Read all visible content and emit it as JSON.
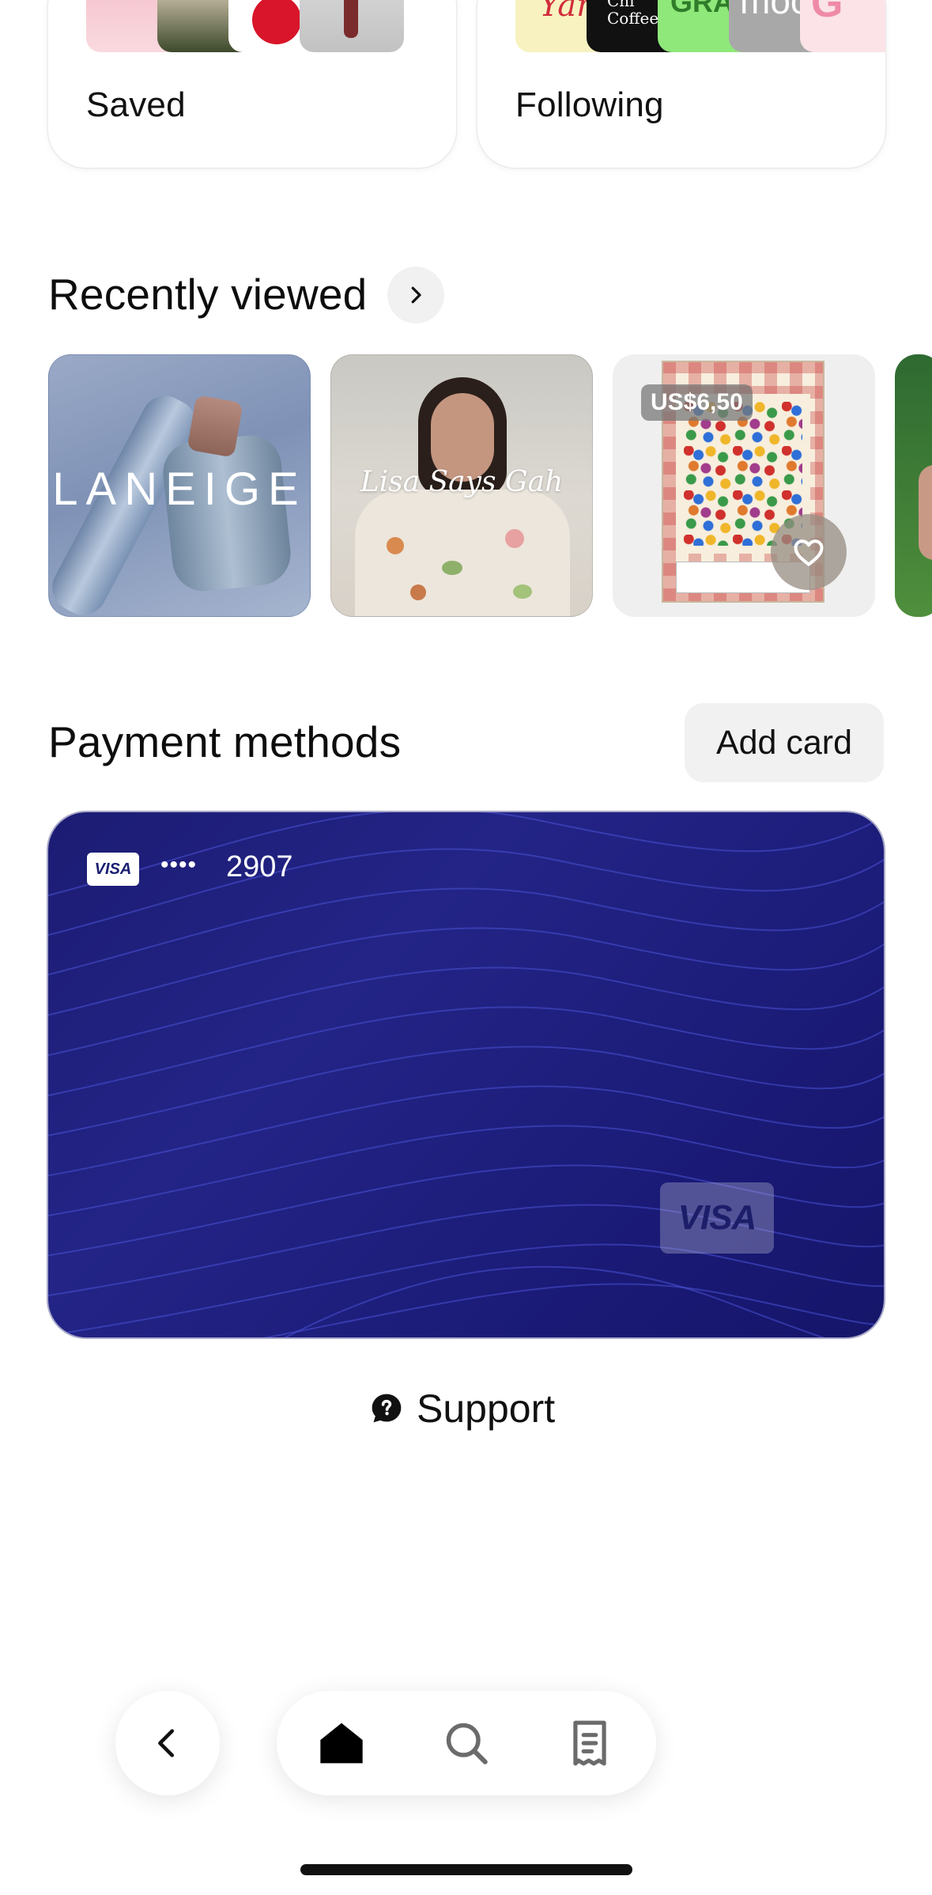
{
  "top_cards": {
    "saved_label": "Saved",
    "following_label": "Following",
    "following_thumbs": [
      "Yan",
      "Chi Coffee",
      "GRAZ",
      "moc",
      "G"
    ]
  },
  "recently_viewed": {
    "title": "Recently viewed",
    "items": [
      {
        "brand_text": "LANEIGE"
      },
      {
        "brand_text": "Lisa Says Gah"
      },
      {
        "price": "US$6,50"
      },
      {}
    ]
  },
  "payment_methods": {
    "title": "Payment methods",
    "add_card_label": "Add card",
    "card": {
      "network_badge": "VISA",
      "masked_dots": "••••",
      "last4": "2907",
      "network_logo": "VISA"
    }
  },
  "support": {
    "label": "Support",
    "icon": "help-circle-icon"
  },
  "bottom_nav": {
    "back_icon": "chevron-left-icon",
    "items": [
      "home-icon",
      "search-icon",
      "receipt-icon"
    ],
    "active": "home-icon"
  },
  "colors": {
    "card_background": "#1f2080",
    "card_wave_lines": "#4a52d6",
    "chip_background": "#f1f1f1",
    "text_primary": "#111111"
  }
}
